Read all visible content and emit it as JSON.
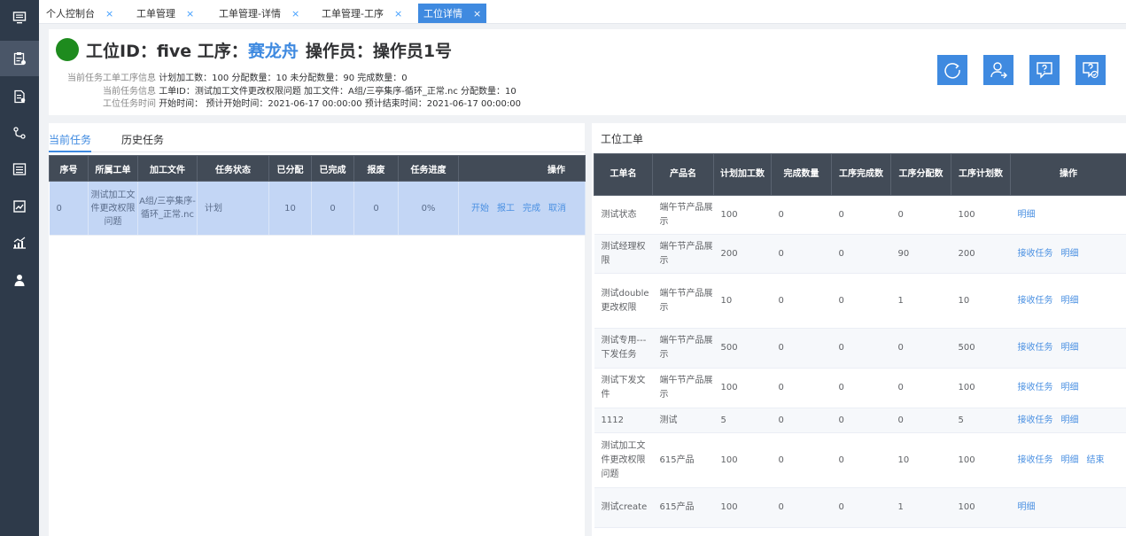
{
  "sidebar": {
    "items": [
      {
        "icon": "monitor-icon"
      },
      {
        "icon": "clipboard-icon"
      },
      {
        "icon": "document-icon"
      },
      {
        "icon": "flow-icon"
      },
      {
        "icon": "list-icon"
      },
      {
        "icon": "chart-icon"
      },
      {
        "icon": "trend-icon"
      },
      {
        "icon": "user-icon"
      }
    ],
    "active_index": 1
  },
  "tabs": [
    {
      "label": "个人控制台",
      "close": "×"
    },
    {
      "label": "工单管理",
      "close": "×"
    },
    {
      "label": "工单管理-详情",
      "close": "×"
    },
    {
      "label": "工单管理-工序",
      "close": "×"
    },
    {
      "label": "工位详情",
      "close": "×"
    }
  ],
  "header": {
    "title_prefix": "工位ID：five 工序：",
    "process_name": "赛龙舟",
    "operator": "操作员：操作员1号",
    "line1_label": "当前任务工单工序信息",
    "line1_value": "计划加工数：100 分配数量：10 未分配数量：90 完成数量：0",
    "line2_label": "当前任务信息",
    "line2_value": "工单ID：测试加工文件更改权限问题 加工文件：A组/三亭集序-循环_正常.nc 分配数量：10",
    "line3_label": "工位任务时间",
    "line3_value": "开始时间： 预计开始时间：2021-06-17 00:00:00 预计结束时间：2021-06-17 00:00:00",
    "buttons": [
      "refresh-icon",
      "assign-user-icon",
      "help-icon",
      "confirm-help-icon"
    ],
    "status_color": "#1e8b1e",
    "accent_color": "#3f8ae0"
  },
  "left": {
    "tabs": [
      "当前任务",
      "历史任务"
    ],
    "columns": [
      "序号",
      "所属工单",
      "加工文件",
      "任务状态",
      "已分配",
      "已完成",
      "报废",
      "任务进度",
      "操作"
    ],
    "rows": [
      {
        "index": "0",
        "order": "测试加工文件更改权限问题",
        "file": "A组/三亭集序-循环_正常.nc",
        "status": "计划",
        "assigned": "10",
        "done": "0",
        "scrap": "0",
        "progress": "0%",
        "ops": [
          "开始",
          "报工",
          "完成",
          "取消"
        ]
      }
    ]
  },
  "right": {
    "title": "工位工单",
    "columns": [
      "工单名",
      "产品名",
      "计划加工数",
      "完成数量",
      "工序完成数",
      "工序分配数",
      "工序计划数",
      "操作"
    ],
    "rows": [
      {
        "name": "测试状态",
        "product": "端午节产品展示",
        "plan": "100",
        "done": "0",
        "proc_done": "0",
        "proc_assigned": "0",
        "proc_plan": "100",
        "ops": [
          "明细"
        ]
      },
      {
        "name": "测试经理权限",
        "product": "端午节产品展示",
        "plan": "200",
        "done": "0",
        "proc_done": "0",
        "proc_assigned": "90",
        "proc_plan": "200",
        "ops": [
          "接收任务",
          "明细"
        ]
      },
      {
        "name": "测试double更改权限",
        "product": "端午节产品展示",
        "plan": "10",
        "done": "0",
        "proc_done": "0",
        "proc_assigned": "1",
        "proc_plan": "10",
        "ops": [
          "接收任务",
          "明细"
        ]
      },
      {
        "name": "测试专用---下发任务",
        "product": "端午节产品展示",
        "plan": "500",
        "done": "0",
        "proc_done": "0",
        "proc_assigned": "0",
        "proc_plan": "500",
        "ops": [
          "接收任务",
          "明细"
        ]
      },
      {
        "name": "测试下发文件",
        "product": "端午节产品展示",
        "plan": "100",
        "done": "0",
        "proc_done": "0",
        "proc_assigned": "0",
        "proc_plan": "100",
        "ops": [
          "接收任务",
          "明细"
        ]
      },
      {
        "name": "1112",
        "product": "测试",
        "plan": "5",
        "done": "0",
        "proc_done": "0",
        "proc_assigned": "0",
        "proc_plan": "5",
        "ops": [
          "接收任务",
          "明细"
        ]
      },
      {
        "name": "测试加工文件更改权限问题",
        "product": "615产品",
        "plan": "100",
        "done": "0",
        "proc_done": "0",
        "proc_assigned": "10",
        "proc_plan": "100",
        "ops": [
          "接收任务",
          "明细",
          "结束"
        ]
      },
      {
        "name": "测试create",
        "product": "615产品",
        "plan": "100",
        "done": "0",
        "proc_done": "0",
        "proc_assigned": "1",
        "proc_plan": "100",
        "ops": [
          "明细"
        ]
      }
    ]
  }
}
